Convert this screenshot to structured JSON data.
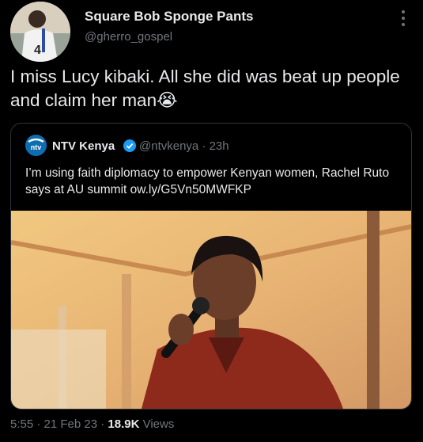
{
  "tweet": {
    "author_name": "Square Bob Sponge Pants",
    "author_handle": "@gherro_gospel",
    "avatar_jersey_text": "4",
    "text": "I miss Lucy kibaki. All she did was beat up people and claim her man😭"
  },
  "quoted_tweet": {
    "logo_text": "ntv",
    "author_name": "NTV Kenya",
    "handle_time": "@ntvkenya · 23h",
    "text": "I’m using faith diplomacy to empower Kenyan women, Rachel Ruto says at AU summit ow.ly/G5Vn50MWFKP"
  },
  "footer": {
    "time_date": "5:55 · 21 Feb 23 · ",
    "views_count": "18.9K",
    "views_label": " Views"
  },
  "colors": {
    "background": "#000000",
    "text_primary": "#e7e9ea",
    "text_secondary": "#71767b",
    "verified_blue": "#1d9bf0",
    "border": "#2f3336"
  }
}
